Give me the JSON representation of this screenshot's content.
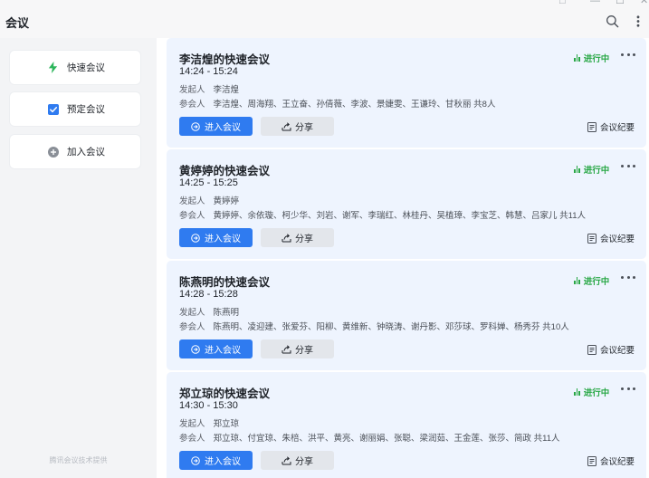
{
  "app": {
    "title": "会议"
  },
  "window_controls": [
    "□",
    "—",
    "☐",
    "✕"
  ],
  "sidebar": {
    "items": [
      {
        "label": "快速会议",
        "icon": "lightning-icon"
      },
      {
        "label": "预定会议",
        "icon": "checkbox-icon"
      },
      {
        "label": "加入会议",
        "icon": "plus-circle-icon"
      }
    ],
    "footer": "腾讯会议技术提供"
  },
  "labels": {
    "host": "发起人",
    "participants": "参会人",
    "enter": "进入会议",
    "share": "分享",
    "minutes": "会议纪要",
    "status": "进行中"
  },
  "colors": {
    "primary": "#2f7bf0",
    "status": "#28a745",
    "card_bg": "#eef4fe"
  },
  "meetings": [
    {
      "title": "李洁煌的快速会议",
      "time": "14:24 - 15:24",
      "host": "李洁煌",
      "participants": "李洁煌、周海翔、王立奋、孙倩薇、李波、景婕雯、王谦玲、甘秋丽 共8人"
    },
    {
      "title": "黄婷婷的快速会议",
      "time": "14:25 - 15:25",
      "host": "黄婷婷",
      "participants": "黄婷婷、余依璇、柯少华、刘岩、谢军、李瑞红、林桂丹、吴植璋、李宝芝、韩慧、吕家儿 共11人"
    },
    {
      "title": "陈燕明的快速会议",
      "time": "14:28 - 15:28",
      "host": "陈燕明",
      "participants": "陈燕明、凌迎建、张爱芬、阳柳、黄维新、钟晓涛、谢丹影、邓莎球、罗科婵、杨秀芬 共10人"
    },
    {
      "title": "郑立琼的快速会议",
      "time": "14:30 - 15:30",
      "host": "郑立琼",
      "participants": "郑立琼、付宜琼、朱棓、洪平、黄亮、谢丽娟、张聪、梁润茹、王金莲、张莎、简政 共11人"
    }
  ]
}
